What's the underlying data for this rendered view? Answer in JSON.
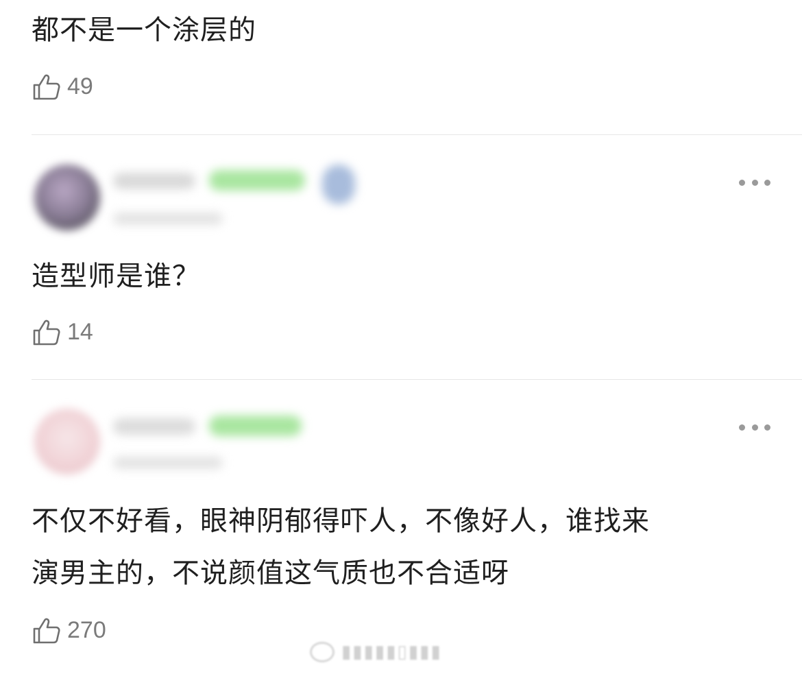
{
  "comments": [
    {
      "text": "都不是一个涂层的",
      "likes": "49"
    },
    {
      "text": "造型师是谁？",
      "likes": "14"
    },
    {
      "text_lines": [
        "不仅不好看，眼神阴郁得吓人，不像好人，谁找来",
        "演男主的，不说颜值这气质也不合适呀"
      ],
      "likes": "270"
    }
  ],
  "icons": {
    "like": "thumbs-up-icon",
    "more": "more-dots-icon",
    "watermark": "weibo-logo-icon"
  },
  "colors": {
    "text": "#1f1f1f",
    "secondary": "#7a7a7a",
    "divider": "#e6e6e6",
    "badge_green": "#9be08a",
    "more_dots": "#9a9a9a"
  }
}
